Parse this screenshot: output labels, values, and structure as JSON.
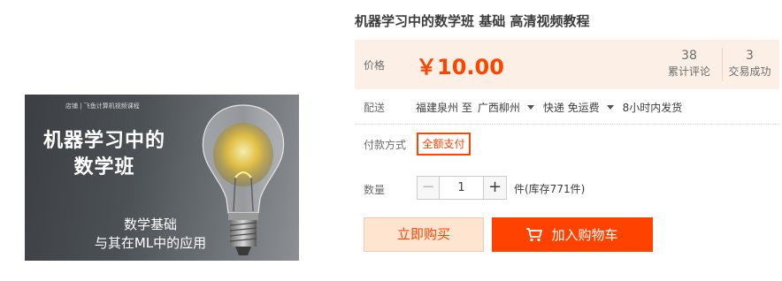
{
  "product_image": {
    "shop_text": "店铺 | 飞鱼计算机视频课程",
    "title_line1": "机器学习中的",
    "title_line2": "数学班",
    "subtitle_line1": "数学基础",
    "subtitle_line2": "与其在ML中的应用"
  },
  "product": {
    "title": "机器学习中的数学班 基础 高清视频教程"
  },
  "price": {
    "label": "价格",
    "value": "￥10.00"
  },
  "stats": {
    "reviews_count": "38",
    "reviews_label": "累计评论",
    "deals_count": "3",
    "deals_label": "交易成功"
  },
  "shipping": {
    "label": "配送",
    "from": "福建泉州 至",
    "to": "广西柳州",
    "method": "快递 免运费",
    "time": "8小时内发货"
  },
  "payment": {
    "label": "付款方式",
    "option": "全额支付"
  },
  "quantity": {
    "label": "数量",
    "minus": "−",
    "value": "1",
    "plus": "+",
    "stock": "件(库存771件)"
  },
  "actions": {
    "buy_now": "立即购买",
    "add_to_cart": "加入购物车"
  },
  "colors": {
    "accent": "#ff4400",
    "cart_button": "#ff4200",
    "price_bg": "#fcefe6",
    "buy_bg": "#ffe4d0"
  }
}
